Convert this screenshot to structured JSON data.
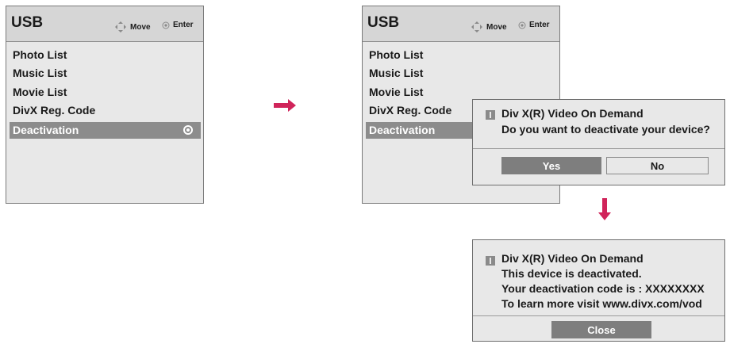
{
  "menu": {
    "title": "USB",
    "legend_move": "Move",
    "legend_enter": "Enter",
    "items": [
      "Photo List",
      "Music List",
      "Movie List",
      "DivX Reg. Code",
      "Deactivation"
    ]
  },
  "confirm_dialog": {
    "title": "Div X(R) Video On Demand",
    "question": "Do you want to deactivate your device?",
    "yes_label": "Yes",
    "no_label": "No"
  },
  "result_dialog": {
    "title": "Div X(R) Video On Demand",
    "lines": [
      "This device is deactivated.",
      "Your deactivation code is : XXXXXXXX",
      "To learn more visit www.divx.com/vod"
    ],
    "close_label": "Close"
  },
  "colors": {
    "arrow": "#d0245a",
    "selection": "#8c8c8c",
    "panel": "#e8e8e8"
  }
}
